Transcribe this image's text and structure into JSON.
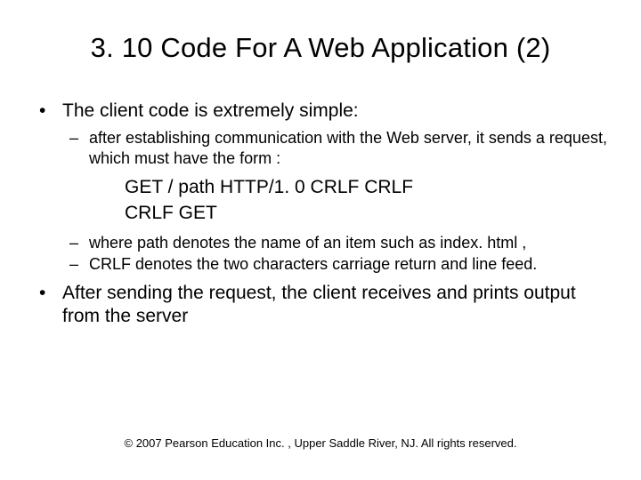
{
  "title": "3. 10 Code For A Web Application (2)",
  "bullets": {
    "b1": "The client code is extremely simple:",
    "b1_s1": "after establishing communication with the Web server, it sends a request, which must have the form :",
    "code1": "GET / path  HTTP/1. 0  CRLF CRLF",
    "code2": "CRLF GET",
    "b1_s2": "where  path  denotes the name of an item such as index. html ,",
    "b1_s3": "CRLF  denotes the two characters carriage return and line feed.",
    "b2": "After sending the request, the client receives and prints output from the server"
  },
  "footer": "© 2007 Pearson Education Inc. , Upper Saddle River, NJ. All rights reserved."
}
